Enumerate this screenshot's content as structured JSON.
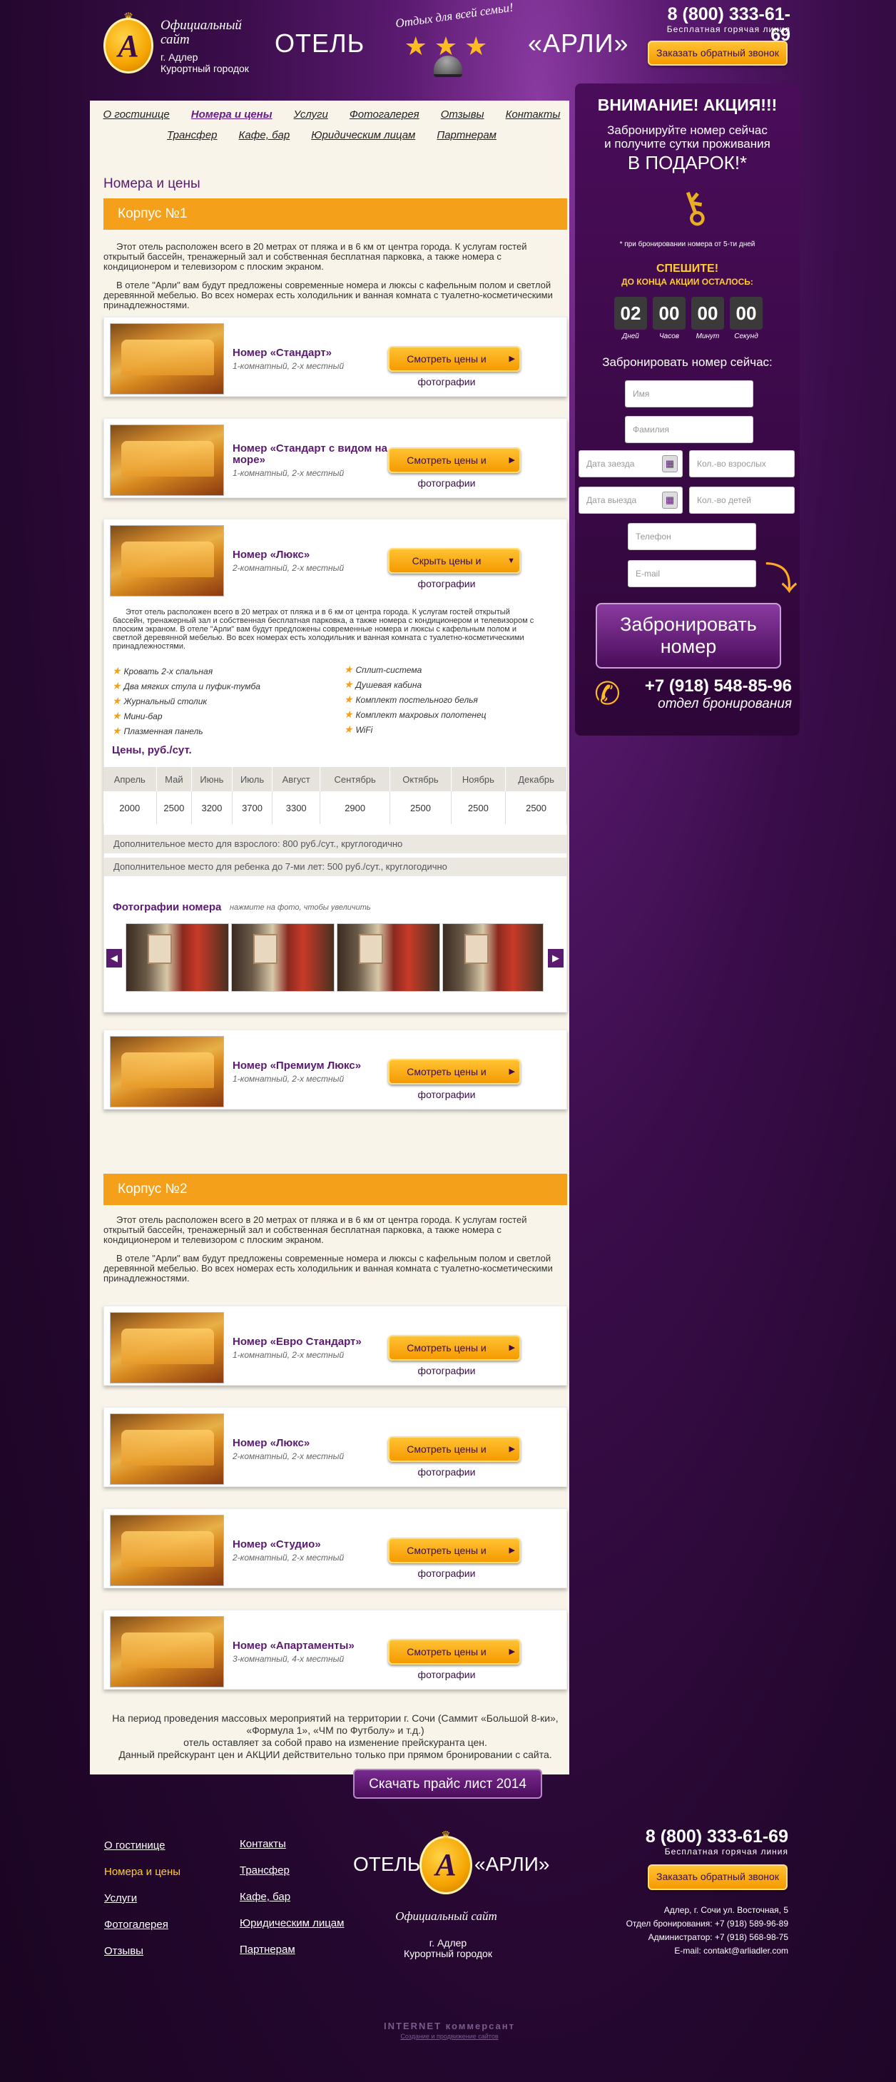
{
  "header": {
    "logo_letter": "A",
    "logo_script": "Официальный сайт",
    "city": "г. Адлер",
    "district": "Курортный городок",
    "hotel_word": "ОТЕЛЬ",
    "hotel_name": "«АРЛИ»",
    "slogan": "Отдых для всей семьи!",
    "phone": "8 (800) 333-61-69",
    "hotline": "Бесплатная горячая линия",
    "callback_label": "Заказать обратный звонок"
  },
  "nav": {
    "row1": [
      "О гостинице",
      "Номера и цены",
      "Услуги",
      "Фотогалерея",
      "Отзывы",
      "Контакты"
    ],
    "row2": [
      "Трансфер",
      "Кафе, бар",
      "Юридическим лицам",
      "Партнерам"
    ],
    "active": "Номера и цены"
  },
  "page_title": "Номера и цены",
  "building1": {
    "title": "Корпус №1",
    "p1": "Этот отель расположен всего в 20 метрах от пляжа  и в 6 км от центра города. К услугам гостей открытый бассейн, тренажерный зал и собственная бесплатная парковка, а также номера с кондиционером и телевизором с плоским экраном.",
    "p2": "В отеле \"Арли\" вам будут предложены современные номера и люксы с кафельным полом и светлой деревянной мебелью. Во всех номерах есть холодильник и ванная комната с туалетно-косметическими принадлежностями."
  },
  "rooms1": [
    {
      "name": "Номер «Стандарт»",
      "sub": "1-комнатный, 2-х местный",
      "btn": "Смотреть цены и фотографии"
    },
    {
      "name": "Номер «Стандарт с видом на море»",
      "sub": "1-комнатный, 2-х местный",
      "btn": "Смотреть цены и фотографии"
    },
    {
      "name": "Номер «Люкс»",
      "sub": "2-комнатный, 2-х местный",
      "btn": "Скрыть цены и фотографии"
    },
    {
      "name": "Номер «Премиум Люкс»",
      "sub": "1-комнатный, 2-х местный",
      "btn": "Смотреть цены и фотографии"
    }
  ],
  "lux_desc": "Этот отель расположен всего в 20 метрах от пляжа  и в 6 км от центра города. К услугам гостей открытый бассейн, тренажерный зал и собственная бесплатная парковка, а также номера с кондиционером и телевизором с плоским экраном. В отеле \"Арли\" вам будут предложены современные номера и люксы с кафельным полом и светлой деревянной мебелью. Во всех номерах есть холодильник и ванная комната с туалетно-косметическими принадлежностями.",
  "amenities_left": [
    "Кровать 2-х спальная",
    "Два мягких стула и пуфик-тумба",
    "Журнальный столик",
    "Мини-бар",
    "Плазменная панель"
  ],
  "amenities_right": [
    "Сплит-система",
    "Душевая кабина",
    "Комплект постельного белья",
    "Комплект махровых полотенец",
    "WiFi"
  ],
  "prices": {
    "title": "Цены, руб./сут.",
    "months": [
      "Апрель",
      "Май",
      "Июнь",
      "Июль",
      "Август",
      "Сентябрь",
      "Октябрь",
      "Ноябрь",
      "Декабрь"
    ],
    "values": [
      "2000",
      "2500",
      "3200",
      "3700",
      "3300",
      "2900",
      "2500",
      "2500",
      "2500"
    ],
    "extra_adult": "Дополнительное место для взрослого: 800 руб./сут., круглогодично",
    "extra_child": "Дополнительное место для ребенка до 7-ми лет: 500 руб./сут., круглогодично"
  },
  "gallery": {
    "title": "Фотографии номера",
    "hint": "нажмите на фото, чтобы увеличить",
    "prev": "◀",
    "next": "▶"
  },
  "building2": {
    "title": "Корпус №2",
    "p1": "Этот отель расположен всего в 20 метрах от пляжа  и в 6 км от центра города. К услугам гостей открытый бассейн, тренажерный зал и собственная бесплатная парковка, а также номера с кондиционером и телевизором с плоским экраном.",
    "p2": "В отеле \"Арли\" вам будут предложены современные номера и люксы с кафельным полом и светлой деревянной мебелью. Во всех номерах есть холодильник и ванная комната с туалетно-косметическими принадлежностями."
  },
  "rooms2": [
    {
      "name": "Номер «Евро Стандарт»",
      "sub": "1-комнатный, 2-х местный",
      "btn": "Смотреть цены и фотографии"
    },
    {
      "name": "Номер «Люкс»",
      "sub": "2-комнатный, 2-х местный",
      "btn": "Смотреть цены и фотографии"
    },
    {
      "name": "Номер «Студио»",
      "sub": "2-комнатный, 2-х местный",
      "btn": "Смотреть цены и фотографии"
    },
    {
      "name": "Номер «Апартаменты»",
      "sub": "3-комнатный, 4-х местный",
      "btn": "Смотреть цены и фотографии"
    }
  ],
  "notice": {
    "line1": "На период проведения массовых мероприятий на территории г. Сочи (Саммит «Большой 8-ки», «Формула 1», «ЧМ по Футболу» и т.д.)",
    "line2": "отель оставляет за собой право на изменение прейскуранта цен.",
    "line3": "Данный прейскурант цен и АКЦИИ действительно только при прямом бронировании с сайта."
  },
  "pricelist_label": "Скачать прайс лист 2014",
  "sidebar": {
    "title": "ВНИМАНИЕ! АКЦИЯ!!!",
    "text1": "Забронируйте номер сейчас",
    "text2": "и получите сутки проживания",
    "gift": "В ПОДАРОК!*",
    "note": "* при бронировании номера от 5-ти дней",
    "hurry": "СПЕШИТЕ!",
    "left": "ДО КОНЦА АКЦИИ ОСТАЛОСЬ:",
    "countdown": [
      {
        "v": "02",
        "l": "Дней"
      },
      {
        "v": "00",
        "l": "Часов"
      },
      {
        "v": "00",
        "l": "Минут"
      },
      {
        "v": "00",
        "l": "Секунд"
      }
    ],
    "book_title": "Забронировать номер сейчас:",
    "name_ph": "Имя",
    "surname_ph": "Фамилия",
    "checkin_ph": "Дата заезда",
    "adults_ph": "Кол.-во взрослых",
    "checkout_ph": "Дата выезда",
    "children_ph": "Кол.-во детей",
    "phone_ph": "Телефон",
    "email_ph": "E-mail",
    "book_btn_line1": "Забронировать",
    "book_btn_line2": "номер",
    "phone": "+7 (918) 548-85-96",
    "phone_sub": "отдел бронирования"
  },
  "footer": {
    "col1": [
      "О гостинице",
      "Номера и цены",
      "Услуги",
      "Фотогалерея",
      "Отзывы"
    ],
    "col2": [
      "Контакты",
      "Трансфер",
      "Кафе, бар",
      "Юридическим лицам",
      "Партнерам"
    ],
    "active": "Номера и цены",
    "hotel_word": "ОТЕЛЬ",
    "hotel_name": "«АРЛИ»",
    "logo_letter": "A",
    "script": "Официальный сайт",
    "city": "г. Адлер",
    "district": "Курортный городок",
    "phone": "8 (800) 333-61-69",
    "hotline": "Бесплатная горячая линия",
    "callback_label": "Заказать обратный звонок",
    "address": "Адлер, г. Сочи ул. Восточная, 5",
    "booking": "Отдел бронирования: +7 (918) 589-96-89",
    "admin": "Администратор: +7 (918) 568-98-75",
    "email": "E-mail: contakt@arliadler.com",
    "dev_logo": "INTERNET коммерсант",
    "dev_text": "Создание и продвижение сайтов"
  },
  "colors": {
    "accent": "#f5a01a",
    "brand": "#5a1a70",
    "background": "#2a0a35",
    "content": "#f8f4ea"
  }
}
